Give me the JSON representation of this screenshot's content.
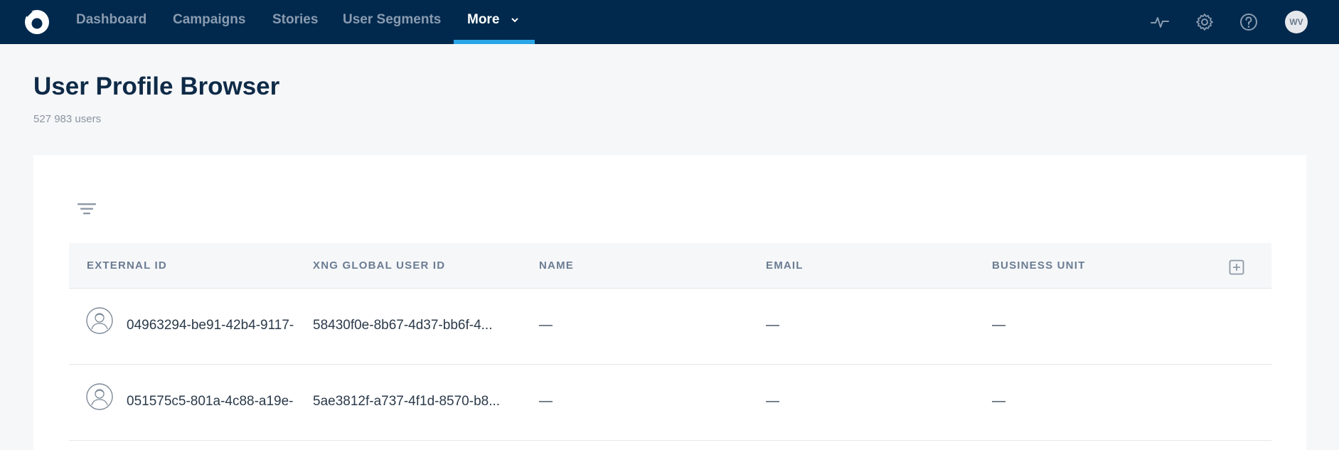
{
  "nav": {
    "items": [
      {
        "label": "Dashboard"
      },
      {
        "label": "Campaigns"
      },
      {
        "label": "Stories"
      },
      {
        "label": "User Segments"
      },
      {
        "label": "More",
        "active": true
      }
    ],
    "user_initials": "WV",
    "active_color": "#2aa6e6",
    "bg_color": "#00294d"
  },
  "page": {
    "title": "User Profile Browser",
    "subtitle": "527 983 users"
  },
  "table": {
    "columns": [
      "EXTERNAL ID",
      "XNG GLOBAL USER ID",
      "NAME",
      "EMAIL",
      "BUSINESS UNIT"
    ],
    "rows": [
      {
        "external_id": "04963294-be91-42b4-9117-",
        "global_id": "58430f0e-8b67-4d37-bb6f-4...",
        "name": "—",
        "email": "—",
        "business_unit": "—"
      },
      {
        "external_id": "051575c5-801a-4c88-a19e-",
        "global_id": "5ae3812f-a737-4f1d-8570-b8...",
        "name": "—",
        "email": "—",
        "business_unit": "—"
      }
    ]
  },
  "icons": {
    "logo": "logo-icon",
    "activity": "activity-icon",
    "settings": "gear-icon",
    "help": "help-icon",
    "filter": "filter-icon",
    "add_column": "add-column-icon",
    "user_avatar": "user-avatar-icon"
  }
}
